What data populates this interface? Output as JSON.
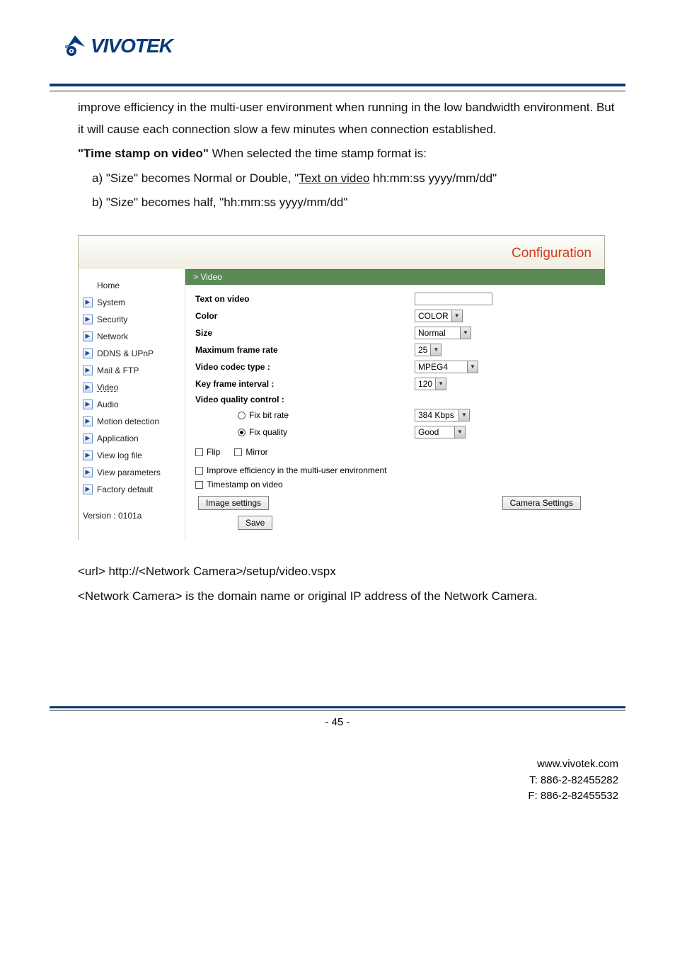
{
  "logo": {
    "text": "VIVOTEK"
  },
  "body": {
    "p1": "improve efficiency in the multi-user environment when running in the low bandwidth environment. But it will cause each connection slow a few minutes when connection established.",
    "p2_bold": "\"Time stamp on video\"",
    "p2_rest": " When selected the time stamp format is:",
    "p3a_pre": "a) \"Size\" becomes Normal or Double, \"",
    "p3a_ul": "Text on video",
    "p3a_post": " hh:mm:ss yyyy/mm/dd\"",
    "p3b": "b) \"Size\" becomes half, \"hh:mm:ss yyyy/mm/dd\"",
    "url_line": "<url> http://<Network Camera>/setup/video.vspx",
    "desc_line": "<Network Camera> is the domain name or original IP address of the Network Camera."
  },
  "config": {
    "title": "Configuration",
    "section": "> Video",
    "sidebar": {
      "home": "Home",
      "items": [
        "System",
        "Security",
        "Network",
        "DDNS & UPnP",
        "Mail & FTP",
        "Video",
        "Audio",
        "Motion detection",
        "Application",
        "View log file",
        "View parameters",
        "Factory default"
      ],
      "version": "Version : 0101a"
    },
    "form": {
      "text_on_video_label": "Text on video",
      "text_on_video_value": "",
      "color_label": "Color",
      "color_value": "COLOR",
      "size_label": "Size",
      "size_value": "Normal",
      "maxfr_label": "Maximum frame rate",
      "maxfr_value": "25",
      "codec_label": "Video codec type :",
      "codec_value": "MPEG4",
      "keyframe_label": "Key frame interval :",
      "keyframe_value": "120",
      "quality_label": "Video quality control :",
      "fixbit_label": "Fix bit rate",
      "fixbit_value": "384 Kbps",
      "fixqual_label": "Fix quality",
      "fixqual_value": "Good",
      "flip_label": "Flip",
      "mirror_label": "Mirror",
      "improve_label": "Improve efficiency in the multi-user environment",
      "timestamp_label": "Timestamp on video",
      "btn_image": "Image settings",
      "btn_camera": "Camera Settings",
      "btn_save": "Save"
    }
  },
  "footer": {
    "page": "- 45 -",
    "site": "www.vivotek.com",
    "tel": "T: 886-2-82455282",
    "fax": "F: 886-2-82455532"
  }
}
